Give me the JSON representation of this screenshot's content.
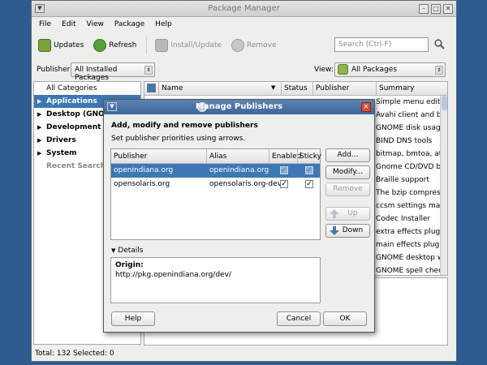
{
  "window": {
    "title": "Package Manager"
  },
  "menu": [
    "File",
    "Edit",
    "View",
    "Package",
    "Help"
  ],
  "toolbar": {
    "updates": "Updates",
    "refresh": "Refresh",
    "install": "Install/Update",
    "remove": "Remove",
    "search_placeholder": "Search (Ctrl-F)"
  },
  "filter": {
    "publisher_label": "Publisher:",
    "publisher_value": "All Installed Packages",
    "view_label": "View:",
    "view_value": "All Packages"
  },
  "sidebar": {
    "items": [
      {
        "label": "All Categories",
        "style": "plain"
      },
      {
        "label": "Applications",
        "style": "selected"
      },
      {
        "label": "Desktop (GNOME)",
        "style": "bold"
      },
      {
        "label": "Development",
        "style": "bold"
      },
      {
        "label": "Drivers",
        "style": "bold"
      },
      {
        "label": "System",
        "style": "bold"
      },
      {
        "label": "Recent Searches",
        "style": "grey"
      }
    ]
  },
  "pkglist": {
    "columns": {
      "name": "Name",
      "status": "Status",
      "publisher": "Publisher",
      "summary": "Summary"
    },
    "summaries": [
      "Simple menu editor f",
      "Avahi client and bridg",
      "GNOME disk usage a",
      "BIND DNS tools",
      "bitmap, bmtoa, atob",
      "Gnome CD/DVD burr",
      "Braille support",
      "The bzip compressio",
      "ccsm settings manac",
      "Codec Installer",
      "extra effects plugins",
      "main effects plugins",
      "GNOME desktop wid",
      "GNOME spell checkov"
    ]
  },
  "statusbar": {
    "text": "Total: 132  Selected: 0"
  },
  "dialog": {
    "title": "Manage Publishers",
    "heading": "Add, modify and remove publishers",
    "subheading": "Set publisher priorities using arrows.",
    "columns": {
      "publisher": "Publisher",
      "alias": "Alias",
      "enabled": "Enabled",
      "sticky": "Sticky"
    },
    "rows": [
      {
        "publisher": "openindiana.org",
        "alias": "openindiana.org",
        "enabled": true,
        "sticky": true
      },
      {
        "publisher": "opensolaris.org",
        "alias": "opensolaris.org-dev",
        "enabled": true,
        "sticky": true
      }
    ],
    "buttons": {
      "add": "Add...",
      "modify": "Modify...",
      "remove": "Remove",
      "up": "Up",
      "down": "Down",
      "help": "Help",
      "cancel": "Cancel",
      "ok": "OK"
    },
    "details_label": "Details",
    "origin_label": "Origin:",
    "origin_value": "http://pkg.openindiana.org/dev/"
  },
  "colors": {
    "selection": "#3c78b4",
    "desktop": "#2e5c8e",
    "close_button": "#d24f3d"
  }
}
